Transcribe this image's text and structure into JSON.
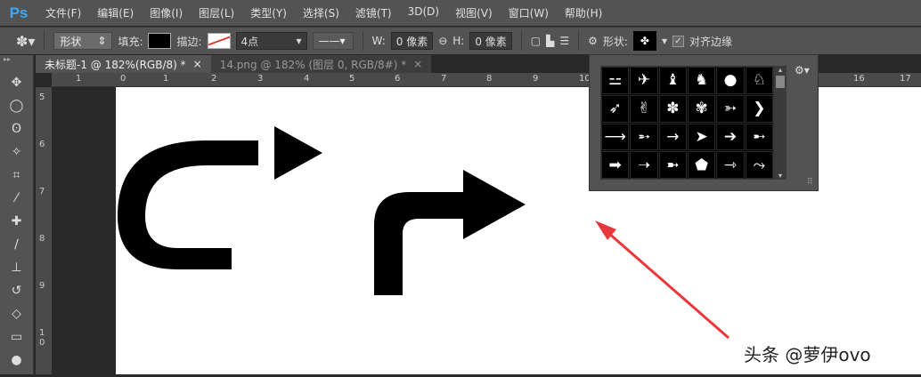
{
  "app": {
    "logo": "Ps"
  },
  "menu": [
    "文件(F)",
    "编辑(E)",
    "图像(I)",
    "图层(L)",
    "类型(Y)",
    "选择(S)",
    "滤镜(T)",
    "3D(D)",
    "视图(V)",
    "窗口(W)",
    "帮助(H)"
  ],
  "options": {
    "mode": "形状",
    "fill_label": "填充:",
    "stroke_label": "描边:",
    "stroke_width": "4点",
    "w_label": "W:",
    "w_value": "0 像素",
    "h_label": "H:",
    "h_value": "0 像素",
    "shape_label": "形状:",
    "align_edges": "对齐边缘",
    "align_checked": true
  },
  "tabs": [
    {
      "label": "未标题-1 @ 182%(RGB/8) *"
    },
    {
      "label": "14.png @ 182% (图层 0, RGB/8#) *"
    }
  ],
  "close_glyph": "×",
  "hruler": [
    "1",
    "0",
    "1",
    "2",
    "3",
    "4",
    "5",
    "6",
    "7",
    "8",
    "9",
    "10",
    "16",
    "17"
  ],
  "vruler": [
    "5",
    "6",
    "7",
    "8",
    "9",
    "1 0"
  ],
  "shapes": [
    "bone",
    "fish",
    "cat",
    "dog",
    "snail",
    "rabbit",
    "bird",
    "dove",
    "paw-print",
    "paw-print-2",
    "arrow-feathered",
    "chevron",
    "arrow-thin",
    "arrow-feather",
    "arrow-line",
    "arrowhead",
    "arrow-bold",
    "arrow-fletched",
    "arrow-block",
    "arrow-tapered",
    "arrow-double-fletch",
    "arrow-pentagon",
    "arrow-right",
    "arrow-wavy"
  ],
  "watermark": "头条 @萝伊ovo",
  "colors": {
    "accent": "#3fa9f5",
    "annotation": "#e8383d"
  }
}
